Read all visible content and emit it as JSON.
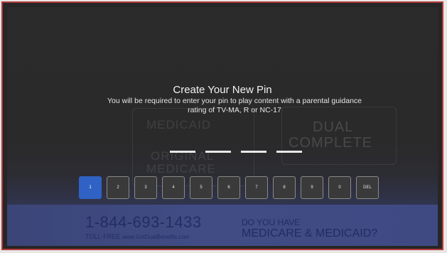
{
  "dialog": {
    "title": "Create Your New Pin",
    "message": "You will be required to enter your pin to play content with a parental guidance rating of TV-MA, R or NC-17"
  },
  "pin": {
    "length": 4,
    "entered": 0
  },
  "keypad": {
    "keys": [
      "1",
      "2",
      "3",
      "4",
      "5",
      "6",
      "7",
      "8",
      "9",
      "0",
      "DEL"
    ],
    "selected_key": "1"
  },
  "background_ad": {
    "box_left_top": "MEDICAID",
    "box_left_mid": "ORIGINAL",
    "box_left_bottom": "MEDICARE",
    "box_right_top": "DUAL",
    "box_right_bottom": "COMPLETE",
    "phone": "1-844-693-1433",
    "toll_free": "TOLL-FREE",
    "url": "www.GotDualBenefits.com",
    "question_line1": "DO YOU HAVE",
    "question_line2": "MEDICARE & MEDICAID?"
  },
  "colors": {
    "frame_border": "#b23a3a",
    "active_key": "#2f62c4",
    "ad_strip": "#414c85"
  }
}
